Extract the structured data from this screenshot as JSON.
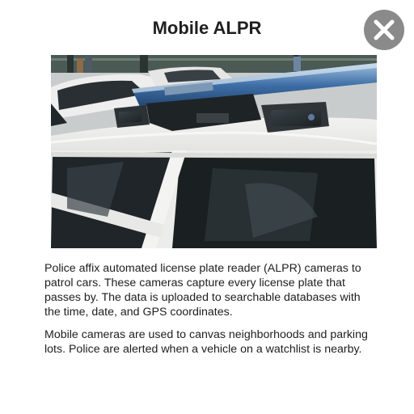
{
  "dialog": {
    "title": "Mobile ALPR",
    "close_icon": "close-icon",
    "image_subject": "police patrol car roof with light bar and mounted ALPR cameras",
    "paragraphs": [
      "Police affix automated license plate reader (ALPR) cameras to patrol cars. These cameras capture every license plate that passes by. The data is uploaded to searchable databases with the time, date, and GPS coordinates.",
      "Mobile cameras are used to canvas neighborhoods and parking lots. Police are alerted when a vehicle on a watchlist is nearby."
    ]
  },
  "colors": {
    "close_button_bg": "#8a8a8a",
    "light_bar_blue": "#3f6fa8",
    "car_body": "#e9eaea"
  }
}
